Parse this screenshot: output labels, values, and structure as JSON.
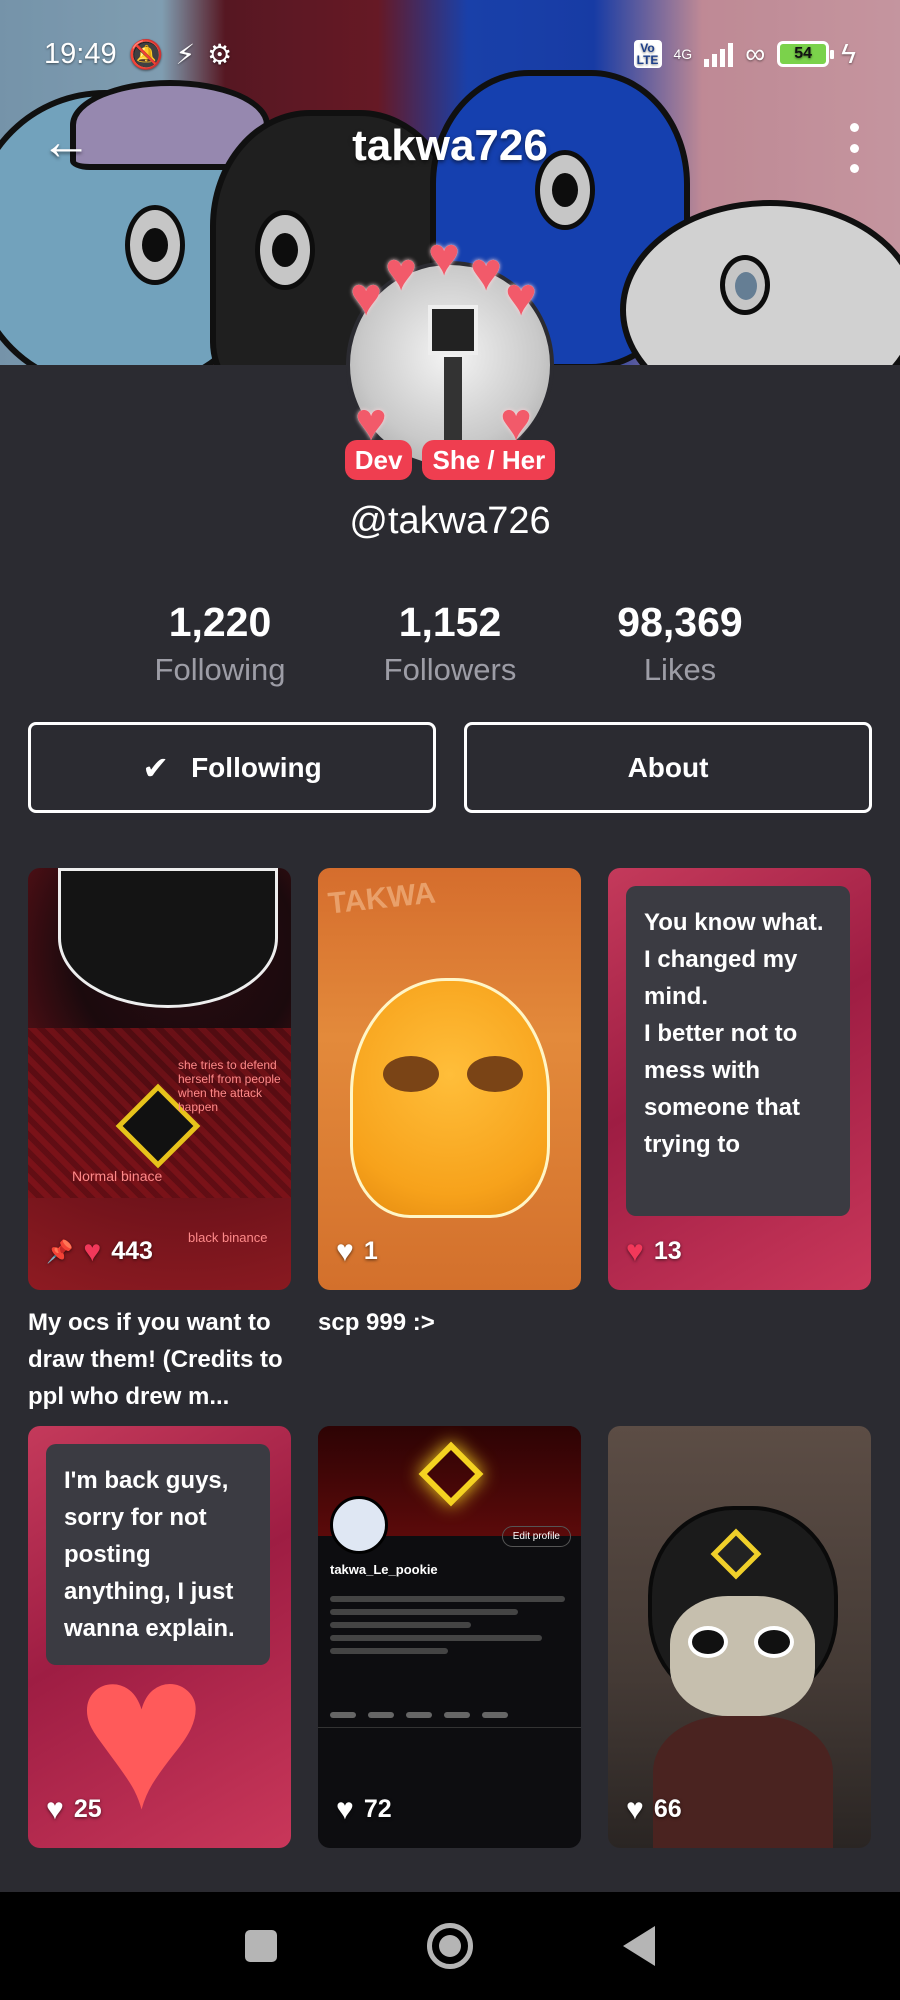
{
  "status_bar": {
    "time": "19:49",
    "network": "4G",
    "volte": "Vo LTE",
    "battery": "54"
  },
  "header": {
    "title": "takwa726"
  },
  "profile": {
    "badges": [
      "Dev",
      "She / Her"
    ],
    "handle": "@takwa726"
  },
  "stats": [
    {
      "value": "1,220",
      "label": "Following"
    },
    {
      "value": "1,152",
      "label": "Followers"
    },
    {
      "value": "98,369",
      "label": "Likes"
    }
  ],
  "actions": {
    "following_label": "Following",
    "about_label": "About"
  },
  "posts": [
    {
      "likes": "443",
      "pinned": true,
      "caption": "My ocs if you want to draw them! (Credits to ppl who drew m..."
    },
    {
      "likes": "1",
      "caption": "scp 999 :>",
      "art_text": "TAKWA"
    },
    {
      "likes": "13",
      "card_text": "You know what. I changed my mind.\nI better not to mess with someone that trying to"
    },
    {
      "likes": "25",
      "card_text": "I'm back guys, sorry for not posting anything, I just wanna explain."
    },
    {
      "likes": "72",
      "screenshot": {
        "name": "takwa_Le_pookie",
        "edit": "Edit profile"
      }
    },
    {
      "likes": "66"
    }
  ],
  "thumb_art_text": {
    "normal": "Normal binace",
    "black": "black binance",
    "note": "she tries to defend herself from people when the attack happen"
  }
}
